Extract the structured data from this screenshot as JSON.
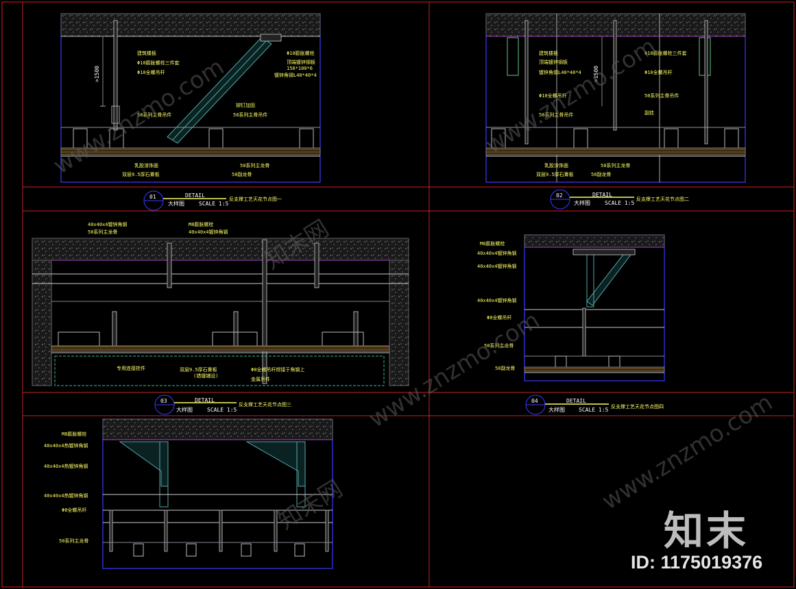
{
  "watermark": {
    "site": "www.znzmo.com",
    "brand_cn": "知末网",
    "brand_logo": "知末",
    "id_text": "ID: 1175019376"
  },
  "colors": {
    "frame": "#cc2222",
    "cad_line": "#3b3bff",
    "hatch": "#888888",
    "label": "#ffff66",
    "title": "#ffffff"
  },
  "detail1": {
    "number": "01",
    "word": "DETAIL",
    "name_cn": "大样图",
    "scale": "SCALE 1:5",
    "desc": "反支撑工艺天花节点图一",
    "dim": ">1500",
    "labels": [
      "建筑楼板",
      "Φ10膨胀螺栓三件套",
      "Φ10全螺吊杆",
      "50系列主骨吊件",
      "Φ10膨胀螺栓",
      "顶端镀锌钢板",
      "150*100*6",
      "镀锌角钢L40*40*4",
      "铆钉加固",
      "50系列主骨吊件",
      "乳胶漆饰面",
      "双层9.5厚石膏板",
      "50系列主龙骨",
      "50副龙骨"
    ]
  },
  "detail2": {
    "number": "02",
    "word": "DETAIL",
    "name_cn": "大样图",
    "scale": "SCALE 1:5",
    "desc": "反支撑工艺天花节点图二",
    "dim": ">1500",
    "labels": [
      "建筑楼板",
      "顶端镀锌钢板",
      "镀锌角钢L40*40*4",
      "Φ10全螺吊杆",
      "50系列主骨吊件",
      "Φ10膨胀螺栓三件套",
      "Φ10全螺吊杆",
      "50系列主骨吊件",
      "副挂",
      "乳胶漆饰面",
      "双层9.5厚石膏板",
      "50系列主龙骨",
      "50副龙骨"
    ]
  },
  "detail3": {
    "number": "03",
    "word": "DETAIL",
    "name_cn": "大样图",
    "scale": "SCALE 1:5",
    "desc": "反支撑工艺天花节点图三",
    "labels": [
      "40x40x4镀锌角钢",
      "50系列主龙骨",
      "M8膨胀螺栓",
      "40x40x4镀锌角钢",
      "专用连接挂件",
      "双层9.5厚石膏板",
      "(错缝铺设)",
      "Φ8全螺吊杆焊接于角钢上",
      "金属吊件"
    ]
  },
  "detail4": {
    "number": "04",
    "word": "DETAIL",
    "name_cn": "大样图",
    "scale": "SCALE 1:5",
    "desc": "反支撑工艺天花节点图四",
    "labels": [
      "M8膨胀螺栓",
      "40x40x4镀锌角钢",
      "40x40x4镀锌角钢",
      "40x40x4镀锌角钢",
      "Φ8全螺吊杆",
      "50系列主龙骨",
      "50副龙骨"
    ]
  },
  "detail5": {
    "labels": [
      "M8膨胀螺栓",
      "40x40x4热镀锌角钢",
      "40x40x4热镀锌角钢",
      "40x40x4热镀锌角钢",
      "Φ8全螺吊杆",
      "50系列主龙骨"
    ]
  }
}
